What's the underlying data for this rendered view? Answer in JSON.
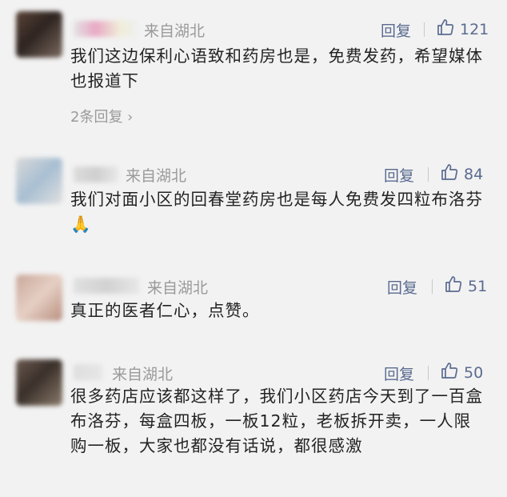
{
  "comments": [
    {
      "location": "来自湖北",
      "reply_label": "回复",
      "likes": "121",
      "text": "我们这边保利心语致和药房也是，免费发药，希望媒体也报道下",
      "sub_replies": "2条回复 ›"
    },
    {
      "location": "来自湖北",
      "reply_label": "回复",
      "likes": "84",
      "text": "我们对面小区的回春堂药房也是每人免费发四粒布洛芬🙏"
    },
    {
      "location": "来自湖北",
      "reply_label": "回复",
      "likes": "51",
      "text": "真正的医者仁心，点赞。"
    },
    {
      "location": "来自湖北",
      "reply_label": "回复",
      "likes": "50",
      "text": "很多药店应该都这样了，我们小区药店今天到了一百盒布洛芬，每盒四板，一板12粒，老板拆开卖，一人限购一板，大家也都没有话说，都很感激"
    }
  ],
  "colors": {
    "background": "#f2f2f2",
    "action_blue": "#5a6b90",
    "meta_gray": "#9a9a9a"
  },
  "icons": {
    "like": "thumbs-up-icon"
  }
}
